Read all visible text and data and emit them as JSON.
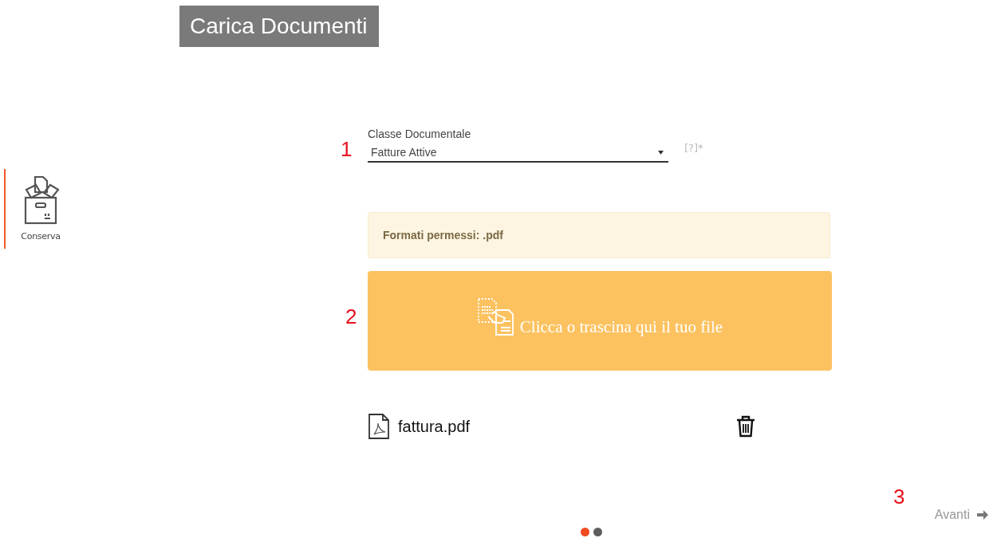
{
  "header": {
    "title": "Carica Documenti"
  },
  "sidebar": {
    "items": [
      {
        "label": "Conserva",
        "selected": true
      }
    ]
  },
  "form": {
    "class_field": {
      "step": "1",
      "label": "Classe Documentale",
      "value": "Fatture Attive",
      "hint": "[?]*"
    },
    "notice": "Formati permessi: .pdf",
    "dropzone": {
      "step": "2",
      "text": "Clicca o trascina qui il tuo file"
    },
    "files": [
      {
        "name": "fattura.pdf"
      }
    ]
  },
  "footer": {
    "step": "3",
    "next": "Avanti",
    "pager": [
      {
        "selected": true
      },
      {
        "selected": false
      }
    ]
  }
}
